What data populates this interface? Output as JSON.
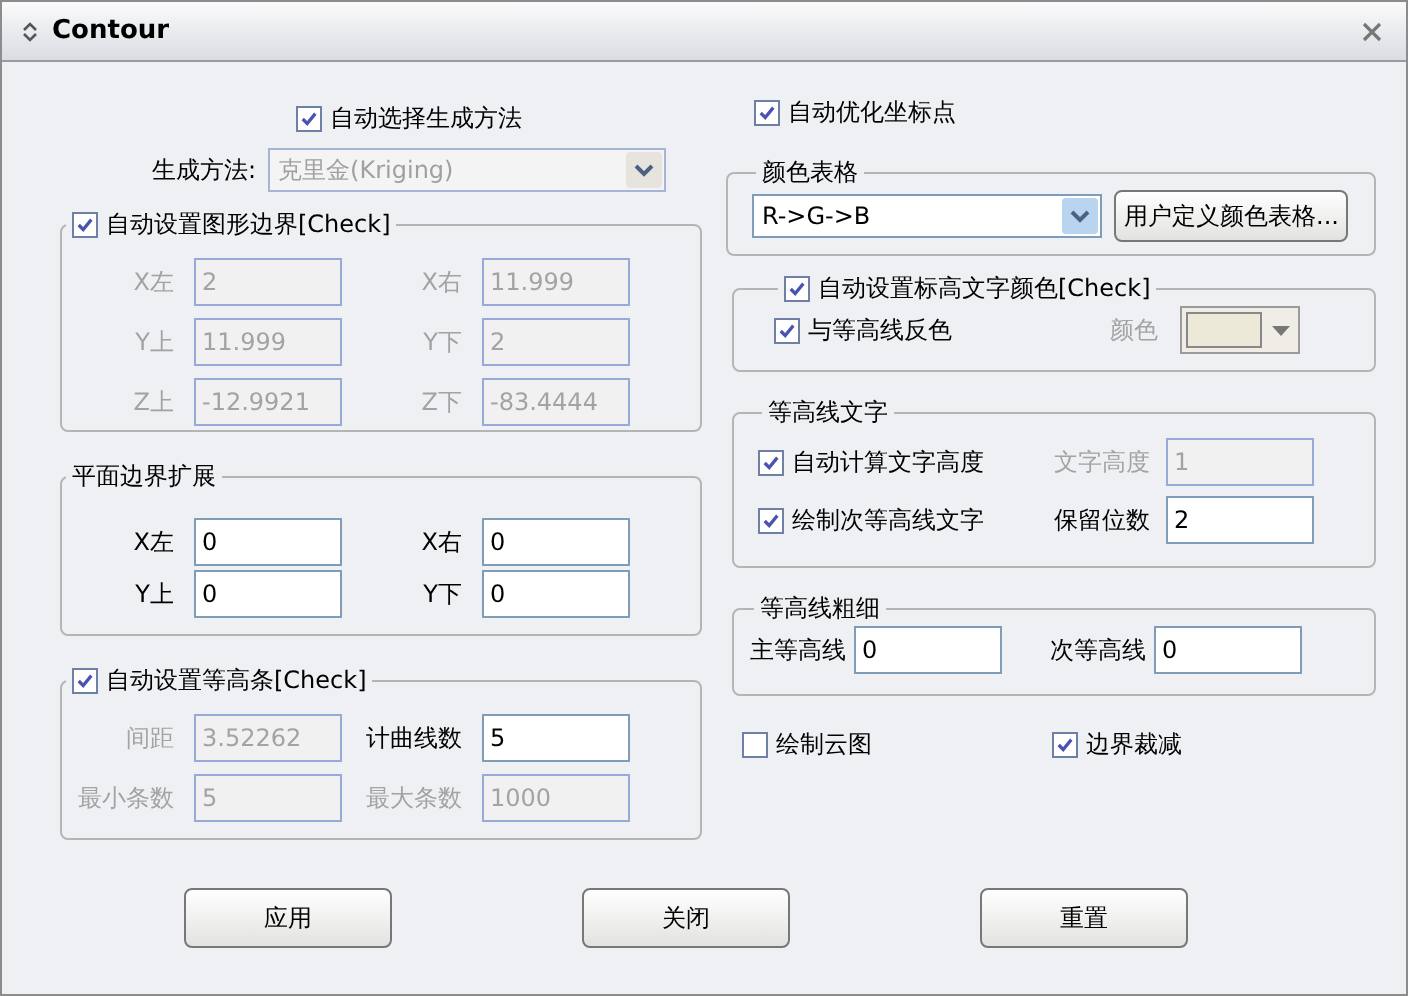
{
  "window": {
    "title": "Contour"
  },
  "auto_method": {
    "label": "自动选择生成方法",
    "checked": true
  },
  "method": {
    "label": "生成方法:",
    "value": "克里金(Kriging)",
    "disabled": true
  },
  "auto_optimize": {
    "label": "自动优化坐标点",
    "checked": true
  },
  "bounds": {
    "label": "自动设置图形边界[Check]",
    "checked": true,
    "fields": [
      {
        "label": "X左",
        "value": "2",
        "disabled": true
      },
      {
        "label": "X右",
        "value": "11.999",
        "disabled": true
      },
      {
        "label": "Y上",
        "value": "11.999",
        "disabled": true
      },
      {
        "label": "Y下",
        "value": "2",
        "disabled": true
      },
      {
        "label": "Z上",
        "value": "-12.9921",
        "disabled": true
      },
      {
        "label": "Z下",
        "value": "-83.4444",
        "disabled": true
      }
    ]
  },
  "extension": {
    "title": "平面边界扩展",
    "fields": [
      {
        "label": "X左",
        "value": "0",
        "disabled": false
      },
      {
        "label": "X右",
        "value": "0",
        "disabled": false
      },
      {
        "label": "Y上",
        "value": "0",
        "disabled": false
      },
      {
        "label": "Y下",
        "value": "0",
        "disabled": false
      }
    ]
  },
  "levels": {
    "label": "自动设置等高条[Check]",
    "checked": true,
    "fields": [
      {
        "label": "间距",
        "value": "3.52262",
        "disabled": true
      },
      {
        "label": "计曲线数",
        "value": "5",
        "disabled": false
      },
      {
        "label": "最小条数",
        "value": "5",
        "disabled": true
      },
      {
        "label": "最大条数",
        "value": "1000",
        "disabled": true
      }
    ]
  },
  "color_table": {
    "title": "颜色表格",
    "value": "R->G->B",
    "button": "用户定义颜色表格..."
  },
  "label_color": {
    "label": "自动设置标高文字颜色[Check]",
    "checked": true,
    "invert": {
      "label": "与等高线反色",
      "checked": true
    },
    "color_label": "颜色",
    "color": "#ece9d8",
    "disabled": true
  },
  "contour_text": {
    "title": "等高线文字",
    "rows": [
      {
        "check": {
          "label": "自动计算文字高度",
          "checked": true
        },
        "field": {
          "label": "文字高度",
          "value": "1",
          "disabled": true
        }
      },
      {
        "check": {
          "label": "绘制次等高线文字",
          "checked": true
        },
        "field": {
          "label": "保留位数",
          "value": "2",
          "disabled": false
        }
      }
    ]
  },
  "thickness": {
    "title": "等高线粗细",
    "fields": [
      {
        "label": "主等高线",
        "value": "0",
        "disabled": false
      },
      {
        "label": "次等高线",
        "value": "0",
        "disabled": false
      }
    ]
  },
  "options": [
    {
      "label": "绘制云图",
      "checked": false
    },
    {
      "label": "边界裁减",
      "checked": true
    }
  ],
  "buttons": [
    "应用",
    "关闭",
    "重置"
  ]
}
